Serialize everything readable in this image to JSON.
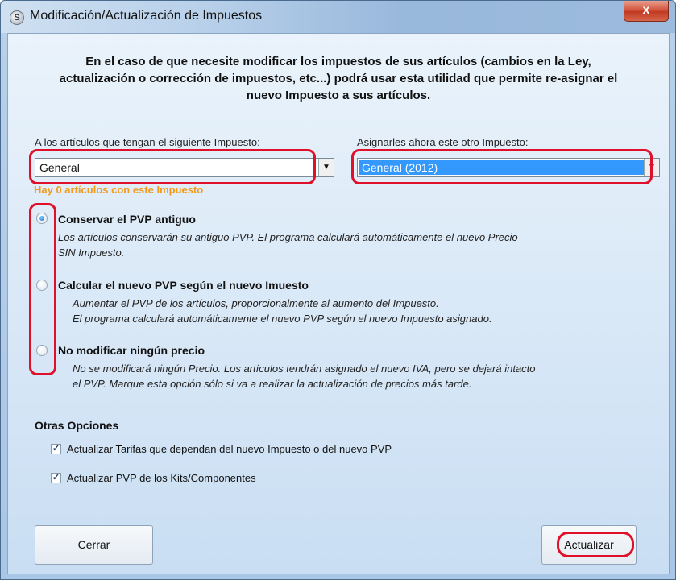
{
  "window": {
    "title": "Modificación/Actualización de Impuestos",
    "app_icon_letter": "S",
    "close_glyph": "x"
  },
  "intro": {
    "line1": "En el caso de que necesite modificar los impuestos de sus artículos (cambios en la Ley,",
    "line2": "actualización o corrección de impuestos, etc...) podrá usar esta utilidad que permite re-asignar el",
    "line3": "nuevo Impuesto a sus artículos."
  },
  "source_tax": {
    "label": "A los artículos que tengan el siguiente Impuesto:",
    "value": "General",
    "count_text": "Hay 0 artículos con este Impuesto",
    "count_color": "#f29a1c"
  },
  "target_tax": {
    "label": "Asignarles ahora este otro Impuesto:",
    "value": "General (2012)",
    "selected_color": "#3399ff"
  },
  "options": [
    {
      "title": "Conservar el PVP antiguo",
      "selected": true,
      "desc_line1": "Los artículos conservarán su antiguo PVP. El programa calculará automáticamente el nuevo Precio",
      "desc_line2": "SIN Impuesto."
    },
    {
      "title": "Calcular el nuevo PVP según el nuevo Imuesto",
      "selected": false,
      "desc_line1": "Aumentar el PVP de los artículos, proporcionalmente al aumento del Impuesto.",
      "desc_line2": "El programa calculará automáticamente el nuevo PVP según el nuevo Impuesto asignado."
    },
    {
      "title": "No modificar ningún precio",
      "selected": false,
      "desc_line1": "No se modificará ningún Precio. Los artículos tendrán asignado el nuevo IVA, pero se dejará intacto",
      "desc_line2": "el PVP. Marque esta opción sólo si va a realizar la actualización de precios más tarde."
    }
  ],
  "other_options": {
    "title": "Otras Opciones",
    "items": [
      {
        "label": "Actualizar Tarifas que dependan del nuevo Impuesto o del nuevo PVP",
        "checked": true
      },
      {
        "label": "Actualizar PVP de los Kits/Componentes",
        "checked": true
      }
    ]
  },
  "buttons": {
    "close": "Cerrar",
    "update": "Actualizar"
  },
  "check_glyph": "✓",
  "arrow_glyph": "▼",
  "highlight_color": "#e0102a"
}
